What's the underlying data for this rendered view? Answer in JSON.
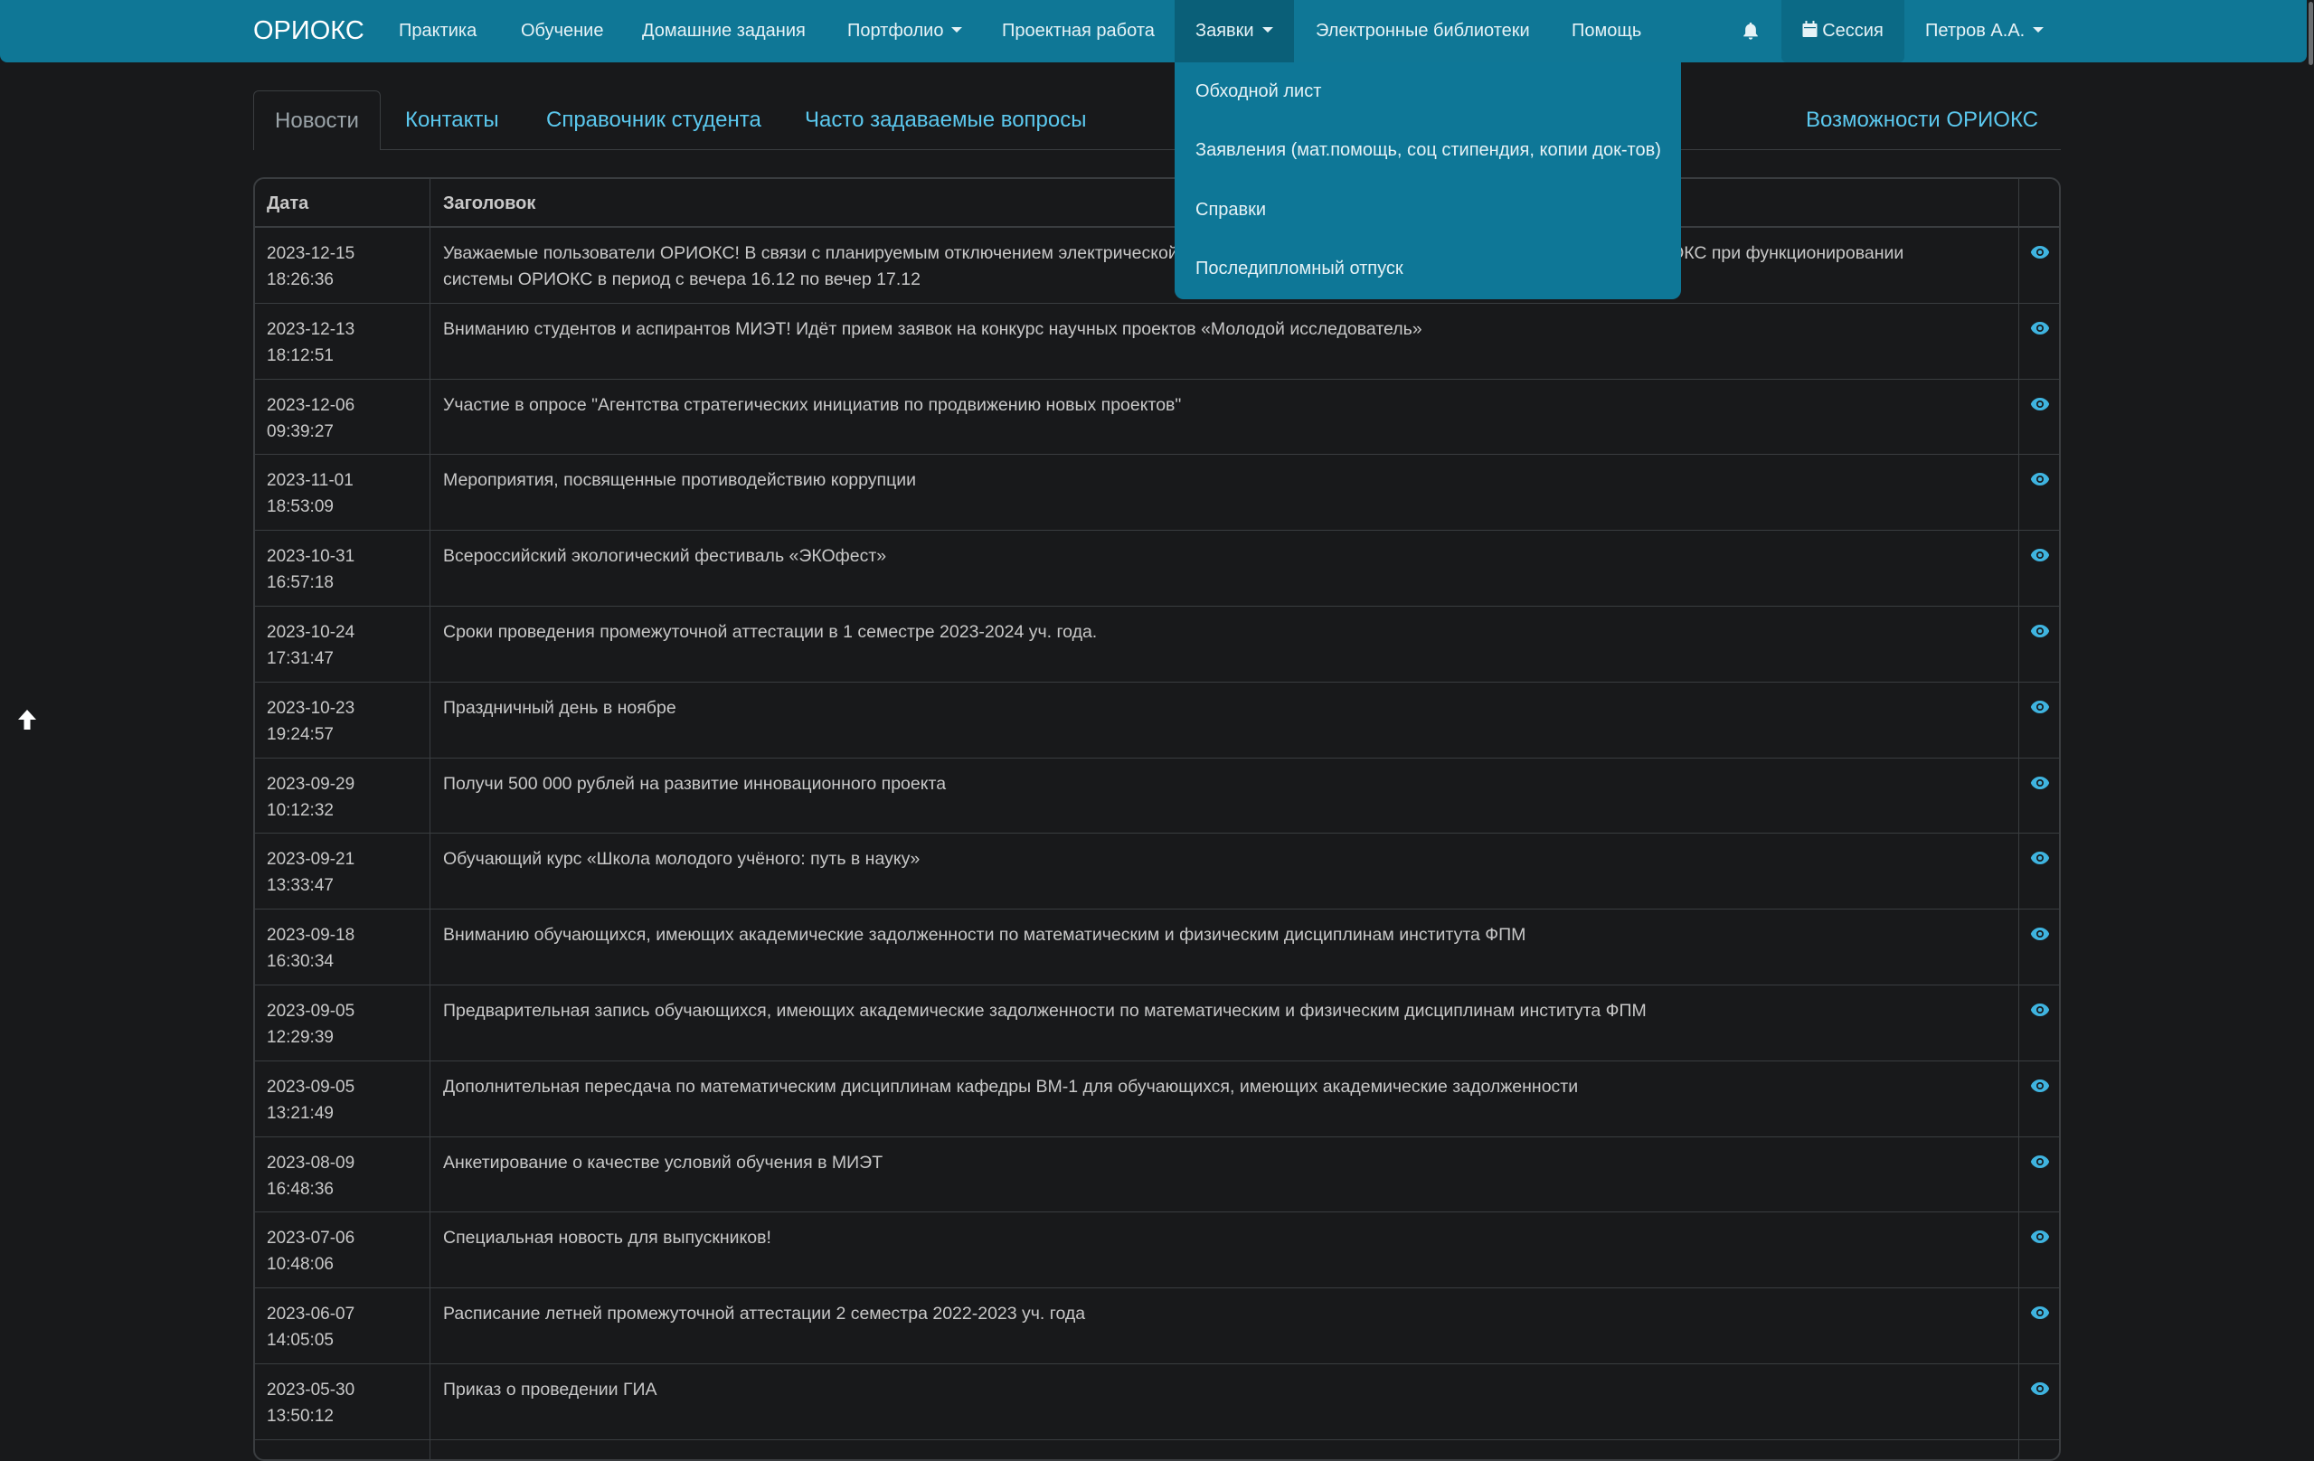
{
  "navbar": {
    "brand": "ОРИОКС",
    "items": [
      {
        "label": "Практика"
      },
      {
        "label": "Обучение"
      },
      {
        "label": "Домашние задания"
      },
      {
        "label": "Портфолио"
      },
      {
        "label": "Проектная работа"
      },
      {
        "label": "Заявки"
      },
      {
        "label": "Электронные библиотеки"
      },
      {
        "label": "Помощь"
      }
    ],
    "session_label": "Сессия",
    "user_label": "Петров А.А.",
    "accent_color": "#0f7796"
  },
  "dropdown": {
    "items": [
      {
        "label": "Обходной лист"
      },
      {
        "label": "Заявления (мат.помощь, соц стипендия, копии док-тов)"
      },
      {
        "label": "Справки"
      },
      {
        "label": "Последипломный отпуск"
      }
    ]
  },
  "tabs": {
    "items": [
      {
        "label": "Новости"
      },
      {
        "label": "Контакты"
      },
      {
        "label": "Справочник студента"
      },
      {
        "label": "Часто задаваемые вопросы"
      }
    ],
    "right_link": "Возможности ОРИОКС"
  },
  "table": {
    "headers": {
      "date": "Дата",
      "title": "Заголовок"
    },
    "rows": [
      {
        "date": "2023-12-15",
        "time": "18:26:36",
        "title": "Уважаемые пользователи ОРИОКС! В связи с планируемым отключением электрической энергии возможны временные сбои в работе системы ОРИОКС при функционировании системы ОРИОКС в период с вечера 16.12 по вечер 17.12"
      },
      {
        "date": "2023-12-13",
        "time": "18:12:51",
        "title": "Вниманию студентов и аспирантов МИЭТ! Идёт прием заявок на конкурс научных проектов «Молодой исследователь»"
      },
      {
        "date": "2023-12-06",
        "time": "09:39:27",
        "title": "Участие в опросе \"Агентства стратегических инициатив по продвижению новых проектов\""
      },
      {
        "date": "2023-11-01",
        "time": "18:53:09",
        "title": "Мероприятия, посвященные противодействию коррупции"
      },
      {
        "date": "2023-10-31",
        "time": "16:57:18",
        "title": "Всероссийский экологический фестиваль «ЭКОфест»"
      },
      {
        "date": "2023-10-24",
        "time": "17:31:47",
        "title": "Сроки проведения промежуточной аттестации в 1 семестре 2023-2024 уч. года."
      },
      {
        "date": "2023-10-23",
        "time": "19:24:57",
        "title": "Праздничный день в ноябре"
      },
      {
        "date": "2023-09-29",
        "time": "10:12:32",
        "title": "Получи 500 000 рублей на развитие инновационного проекта"
      },
      {
        "date": "2023-09-21",
        "time": "13:33:47",
        "title": "Обучающий курс «Школа молодого учёного: путь в науку»"
      },
      {
        "date": "2023-09-18",
        "time": "16:30:34",
        "title": "Вниманию обучающихся, имеющих академические задолженности по математическим и физическим дисциплинам института ФПМ"
      },
      {
        "date": "2023-09-05",
        "time": "12:29:39",
        "title": "Предварительная запись обучающихся, имеющих академические задолженности по математическим и физическим дисциплинам института ФПМ"
      },
      {
        "date": "2023-09-05",
        "time": "13:21:49",
        "title": "Дополнительная пересдача по математическим дисциплинам кафедры ВМ-1 для обучающихся, имеющих академические задолженности"
      },
      {
        "date": "2023-08-09",
        "time": "16:48:36",
        "title": "Анкетирование о качестве условий обучения в МИЭТ"
      },
      {
        "date": "2023-07-06",
        "time": "10:48:06",
        "title": "Специальная новость для выпускников!"
      },
      {
        "date": "2023-06-07",
        "time": "14:05:05",
        "title": "Расписание летней промежуточной аттестации 2 семестра 2022-2023 уч. года"
      },
      {
        "date": "2023-05-30",
        "time": "13:50:12",
        "title": "Приказ о проведении ГИА"
      }
    ]
  }
}
